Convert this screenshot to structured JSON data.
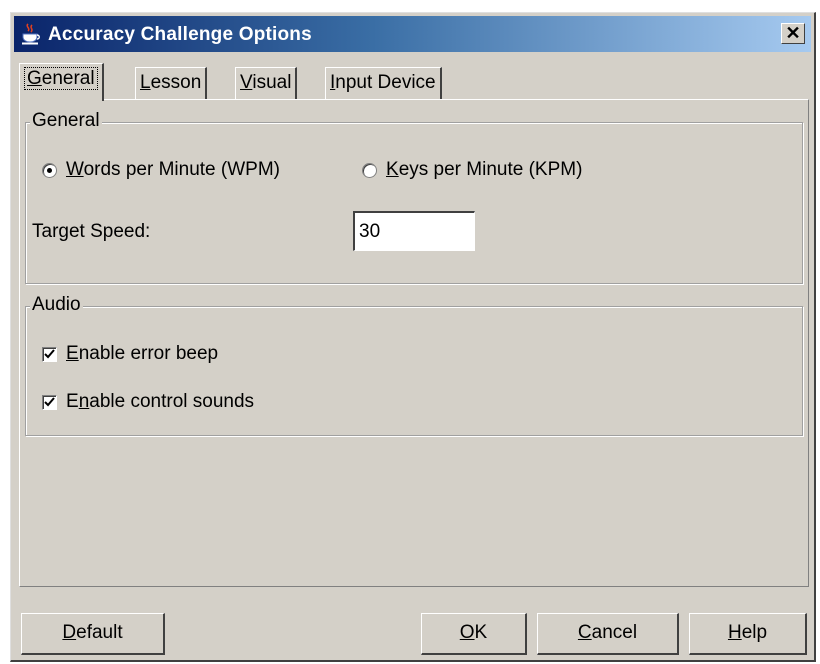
{
  "window": {
    "title": "Accuracy Challenge Options",
    "close_glyph": "✕"
  },
  "icons": {
    "app": "java-cup-icon",
    "close": "close-icon"
  },
  "tabs": [
    {
      "label": "General",
      "mnemonic_index": 0,
      "active": true
    },
    {
      "label": "Lesson",
      "mnemonic_index": 0,
      "active": false
    },
    {
      "label": "Visual",
      "mnemonic_index": 0,
      "active": false
    },
    {
      "label": "Input Device",
      "mnemonic_index": 0,
      "active": false
    }
  ],
  "general_group": {
    "legend": "General",
    "radio_wpm": {
      "label": "Words per Minute (WPM)",
      "selected": true
    },
    "radio_kpm": {
      "label": "Keys per Minute (KPM)",
      "selected": false
    },
    "target_speed_label": "Target Speed:",
    "target_speed_value": "30"
  },
  "audio_group": {
    "legend": "Audio",
    "error_beep": {
      "label": "Enable error beep",
      "checked": true
    },
    "control_sounds": {
      "label": "Enable control sounds",
      "checked": true
    }
  },
  "buttons": {
    "default": "Default",
    "ok": "OK",
    "cancel": "Cancel",
    "help": "Help"
  },
  "colors": {
    "face": "#d4d0c8",
    "title_start": "#0a246a",
    "title_end": "#a6caf0"
  }
}
